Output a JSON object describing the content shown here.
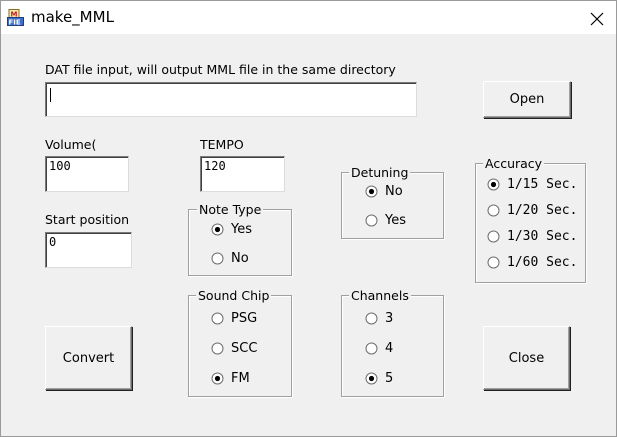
{
  "window": {
    "title": "make_MML",
    "app_icon": "file-icon",
    "close_icon": "close-icon"
  },
  "file_input": {
    "label": "DAT file input, will output MML file in the same directory",
    "value": ""
  },
  "buttons": {
    "open": "Open",
    "convert": "Convert",
    "close": "Close"
  },
  "volume": {
    "label": "Volume(",
    "value": "100"
  },
  "tempo": {
    "label": "TEMPO",
    "value": "120"
  },
  "start_position": {
    "label": "Start position",
    "value": "0"
  },
  "note_type": {
    "legend": "Note Type",
    "options": [
      "Yes",
      "No"
    ],
    "selected": "Yes"
  },
  "sound_chip": {
    "legend": "Sound Chip",
    "options": [
      "PSG",
      "SCC",
      "FM"
    ],
    "selected": "FM"
  },
  "detuning": {
    "legend": "Detuning",
    "options": [
      "No",
      "Yes"
    ],
    "selected": "No"
  },
  "channels": {
    "legend": "Channels",
    "options": [
      "3",
      "4",
      "5"
    ],
    "selected": "5"
  },
  "accuracy": {
    "legend": "Accuracy",
    "options": [
      "1/15 Sec.",
      "1/20 Sec.",
      "1/30 Sec.",
      "1/60 Sec."
    ],
    "selected": "1/15 Sec."
  }
}
